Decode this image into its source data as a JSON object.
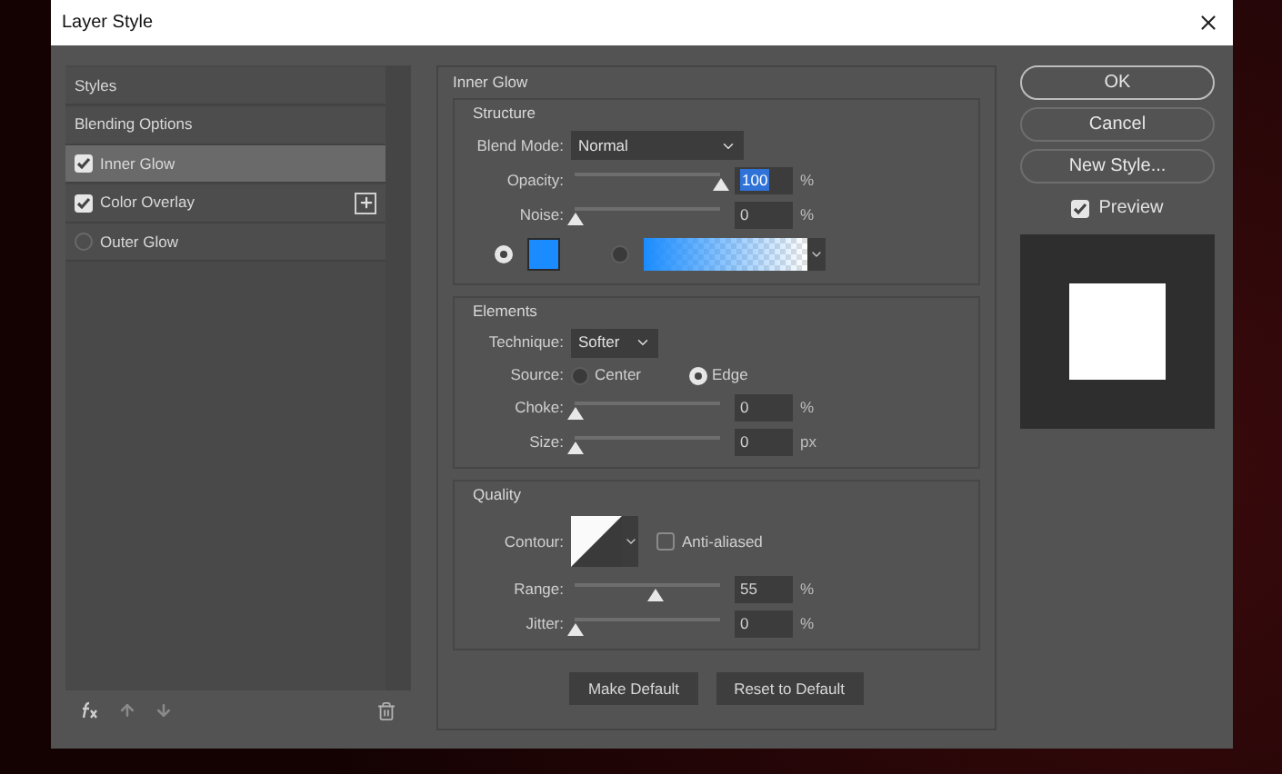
{
  "window": {
    "title": "Layer Style"
  },
  "sidebar": {
    "items": [
      {
        "label": "Styles",
        "kind": "plain",
        "selected": false,
        "addable": false
      },
      {
        "label": "Blending Options",
        "kind": "plain",
        "selected": false,
        "addable": false
      },
      {
        "label": "Inner Glow",
        "kind": "effect",
        "checked": true,
        "selected": true,
        "addable": false
      },
      {
        "label": "Color Overlay",
        "kind": "effect",
        "checked": true,
        "selected": false,
        "addable": true
      },
      {
        "label": "Outer Glow",
        "kind": "effect",
        "checked": false,
        "selected": false,
        "addable": false
      }
    ]
  },
  "panel": {
    "title": "Inner Glow",
    "sections": [
      {
        "title": "Structure",
        "rows": [
          {
            "kind": "select",
            "label": "Blend Mode:",
            "value": "Normal",
            "wide": true
          },
          {
            "kind": "slider",
            "label": "Opacity:",
            "value": "100",
            "unit": "%",
            "level": 1,
            "highlighted": true
          },
          {
            "kind": "slider",
            "label": "Noise:",
            "value": "0",
            "unit": "%",
            "level": 0,
            "highlighted": false
          },
          {
            "kind": "fill",
            "solid_selected": true,
            "gradient_selected": false,
            "color": "#1a8cff"
          }
        ]
      },
      {
        "title": "Elements",
        "rows": [
          {
            "kind": "select",
            "label": "Technique:",
            "value": "Softer",
            "wide": false
          },
          {
            "kind": "radio",
            "label": "Source:",
            "options": [
              {
                "label": "Center",
                "selected": false
              },
              {
                "label": "Edge",
                "selected": true
              }
            ]
          },
          {
            "kind": "slider",
            "label": "Choke:",
            "value": "0",
            "unit": "%",
            "level": 0,
            "highlighted": false
          },
          {
            "kind": "slider",
            "label": "Size:",
            "value": "0",
            "unit": "px",
            "level": 0,
            "highlighted": false
          }
        ]
      },
      {
        "title": "Quality",
        "rows": [
          {
            "kind": "contour",
            "label": "Contour:",
            "option": "Anti-aliased",
            "checked": false
          },
          {
            "kind": "slider",
            "label": "Range:",
            "value": "55",
            "unit": "%",
            "level": 0.55,
            "highlighted": false
          },
          {
            "kind": "slider",
            "label": "Jitter:",
            "value": "0",
            "unit": "%",
            "level": 0,
            "highlighted": false
          }
        ]
      }
    ],
    "buttons": [
      "Make Default",
      "Reset to Default"
    ]
  },
  "actions": [
    {
      "label": "OK",
      "default": true
    },
    {
      "label": "Cancel",
      "default": false
    },
    {
      "label": "New Style...",
      "default": false
    }
  ],
  "preview": {
    "label": "Preview",
    "checked": true
  }
}
